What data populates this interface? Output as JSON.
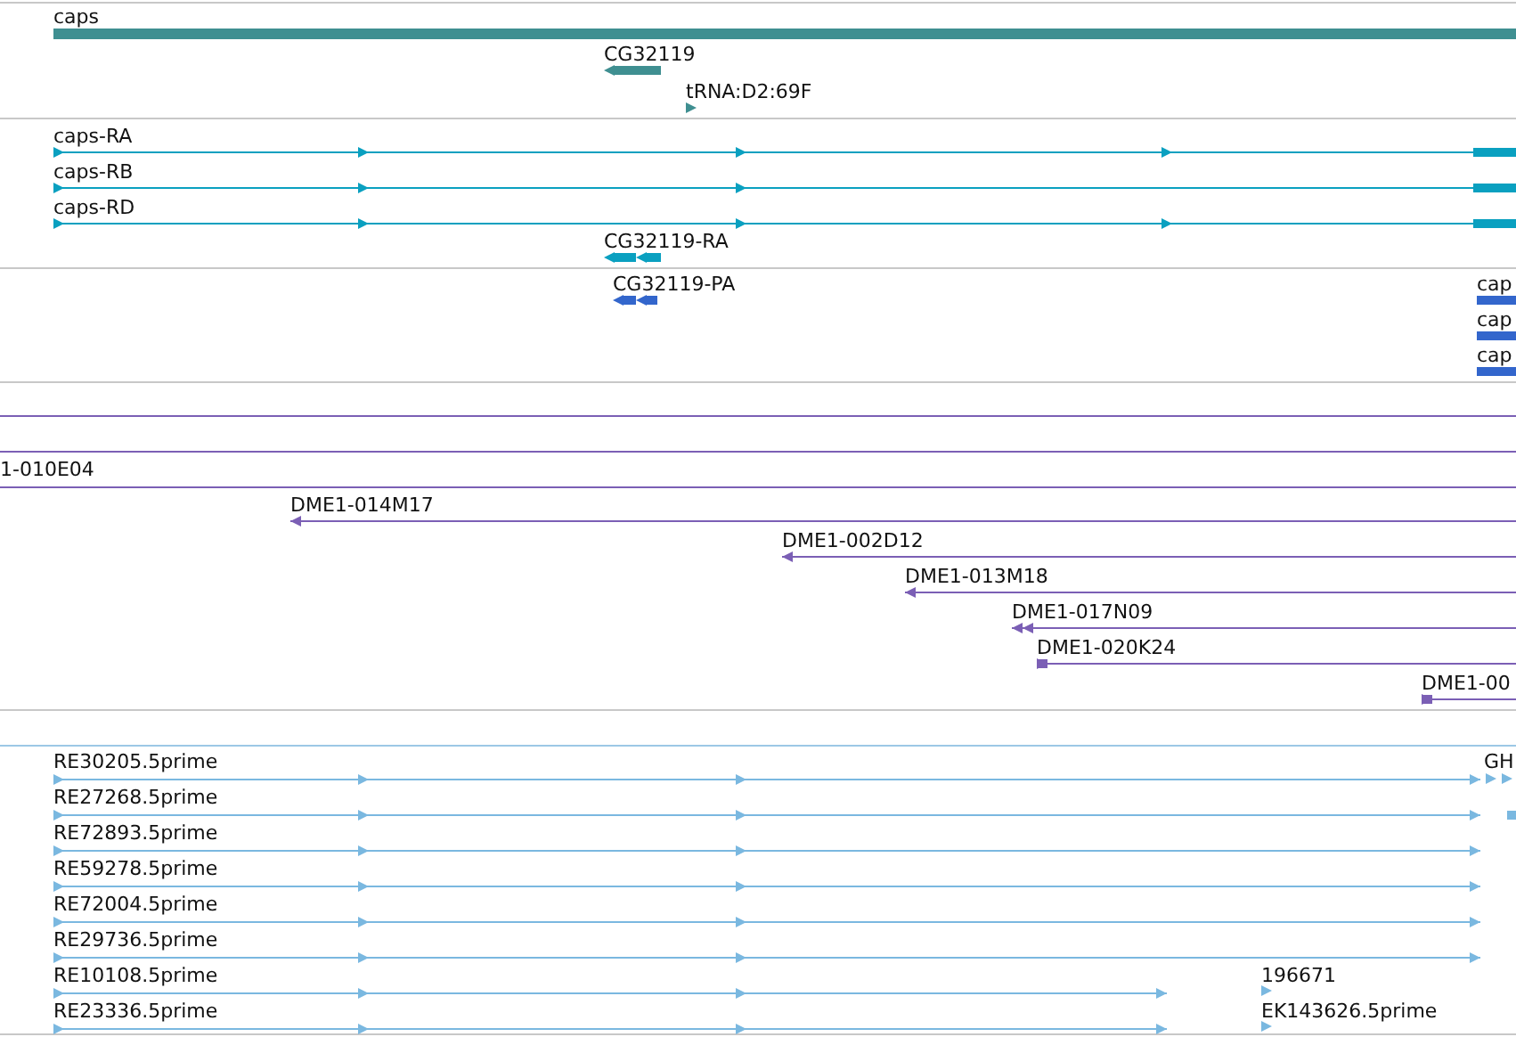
{
  "tracks": [
    {
      "color": "#3f8f91",
      "features": [
        {
          "kind": "block",
          "label": "caps"
        },
        {
          "kind": "block",
          "label": "CG32119",
          "reverse": true
        },
        {
          "kind": "arrow",
          "label": "tRNA:D2:69F",
          "reverse": false
        }
      ]
    },
    {
      "color": "#0aa0c0",
      "features": [
        {
          "kind": "transcript",
          "label": "caps-RA",
          "reverse": false
        },
        {
          "kind": "transcript",
          "label": "caps-RB",
          "reverse": false
        },
        {
          "kind": "transcript",
          "label": "caps-RD",
          "reverse": false
        },
        {
          "kind": "block",
          "label": "CG32119-RA",
          "reverse": true
        }
      ]
    },
    {
      "color": "#3366cc",
      "features": [
        {
          "kind": "block",
          "label": "CG32119-PA",
          "reverse": true
        },
        {
          "kind": "block",
          "label": "cap"
        },
        {
          "kind": "block",
          "label": "cap"
        },
        {
          "kind": "block",
          "label": "cap"
        }
      ]
    },
    {
      "color": "#7b5fb5",
      "features": [
        {
          "kind": "line"
        },
        {
          "kind": "line"
        },
        {
          "kind": "line",
          "label": "1-010E04"
        },
        {
          "kind": "transcript",
          "label": "DME1-014M17",
          "reverse": true
        },
        {
          "kind": "transcript",
          "label": "DME1-002D12",
          "reverse": true
        },
        {
          "kind": "transcript",
          "label": "DME1-013M18",
          "reverse": true
        },
        {
          "kind": "transcript",
          "label": "DME1-017N09",
          "reverse": true
        },
        {
          "kind": "transcript",
          "label": "DME1-020K24",
          "reverse": false
        },
        {
          "kind": "transcript",
          "label": "DME1-00",
          "reverse": false
        }
      ]
    },
    {
      "color": "#7ab8e0",
      "features": [
        {
          "kind": "transcript",
          "label": "RE30205.5prime",
          "reverse": false
        },
        {
          "kind": "transcript",
          "label": "RE27268.5prime",
          "reverse": false
        },
        {
          "kind": "transcript",
          "label": "RE72893.5prime",
          "reverse": false
        },
        {
          "kind": "transcript",
          "label": "RE59278.5prime",
          "reverse": false
        },
        {
          "kind": "transcript",
          "label": "RE72004.5prime",
          "reverse": false
        },
        {
          "kind": "transcript",
          "label": "RE29736.5prime",
          "reverse": false
        },
        {
          "kind": "transcript",
          "label": "RE10108.5prime",
          "reverse": false
        },
        {
          "kind": "transcript",
          "label": "RE23336.5prime",
          "reverse": false
        },
        {
          "kind": "arrow",
          "label": "GH",
          "reverse": false
        },
        {
          "kind": "block"
        },
        {
          "kind": "arrow",
          "label": "196671",
          "reverse": false
        },
        {
          "kind": "arrow",
          "label": "EK143626.5prime",
          "reverse": false
        }
      ]
    }
  ]
}
